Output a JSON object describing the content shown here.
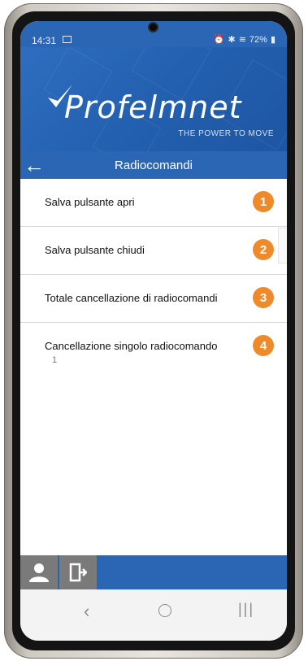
{
  "status": {
    "time": "14:31",
    "battery": "72%"
  },
  "brand": {
    "name": "Profelmnet",
    "tagline": "THE POWER TO MOVE"
  },
  "header": {
    "title": "Radiocomandi"
  },
  "list": [
    {
      "label": "Salva pulsante apri",
      "badge": "1",
      "sub": ""
    },
    {
      "label": "Salva pulsante chiudi",
      "badge": "2",
      "sub": ""
    },
    {
      "label": "Totale cancellazione di radiocomandi",
      "badge": "3",
      "sub": ""
    },
    {
      "label": "Cancellazione singolo radiocomando",
      "badge": "4",
      "sub": "1"
    }
  ],
  "colors": {
    "primary": "#2b66b5",
    "badge": "#ef8a2b"
  }
}
